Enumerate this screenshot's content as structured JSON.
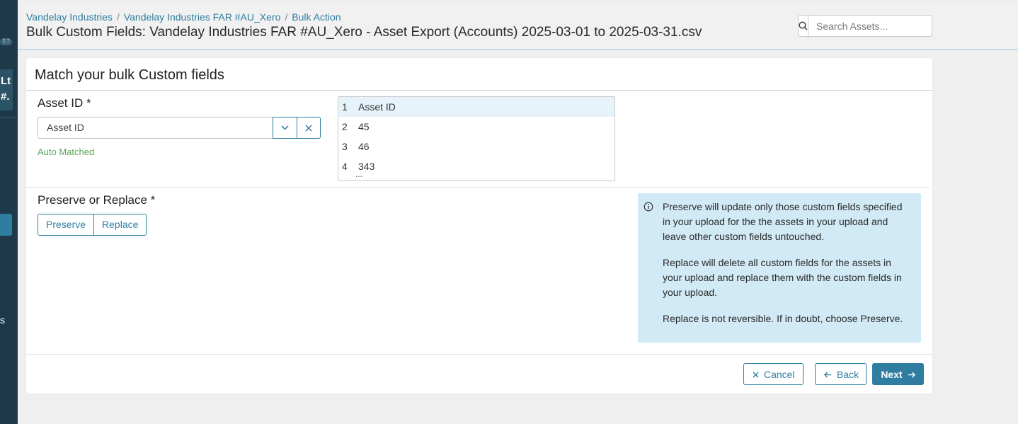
{
  "sidebar": {
    "version_badge": "2.7",
    "org_line1": "Lt",
    "org_line2": "#.",
    "bottom_letter": "s"
  },
  "header": {
    "breadcrumb": [
      "Vandelay Industries",
      "Vandelay Industries FAR #AU_Xero",
      "Bulk Action"
    ],
    "title": "Bulk Custom Fields: Vandelay Industries FAR #AU_Xero - Asset Export (Accounts) 2025-03-01 to 2025-03-31.csv",
    "search_placeholder": "Search Assets..."
  },
  "card": {
    "title": "Match your bulk Custom fields",
    "asset_id": {
      "label": "Asset ID *",
      "selected": "Asset ID",
      "status": "Auto Matched"
    },
    "preview": {
      "rows": [
        {
          "num": "1",
          "value": "Asset ID"
        },
        {
          "num": "2",
          "value": "45"
        },
        {
          "num": "3",
          "value": "46"
        },
        {
          "num": "4",
          "value": "343"
        }
      ],
      "more": "..."
    },
    "preserve_replace": {
      "label": "Preserve or Replace *",
      "options": [
        "Preserve",
        "Replace"
      ]
    },
    "info": [
      "Preserve will update only those custom fields specified in your upload for the the assets in your upload and leave other custom fields untouched.",
      "Replace will delete all custom fields for the assets in your upload and replace them with the custom fields in your upload.",
      "Replace is not reversible. If in doubt, choose Preserve."
    ],
    "actions": {
      "cancel": "Cancel",
      "back": "Back",
      "next": "Next"
    }
  },
  "colors": {
    "accent": "#2f7ea1",
    "sidebar": "#1e3a4a",
    "info_bg": "#d2eaf6",
    "success": "#5aa55a"
  }
}
